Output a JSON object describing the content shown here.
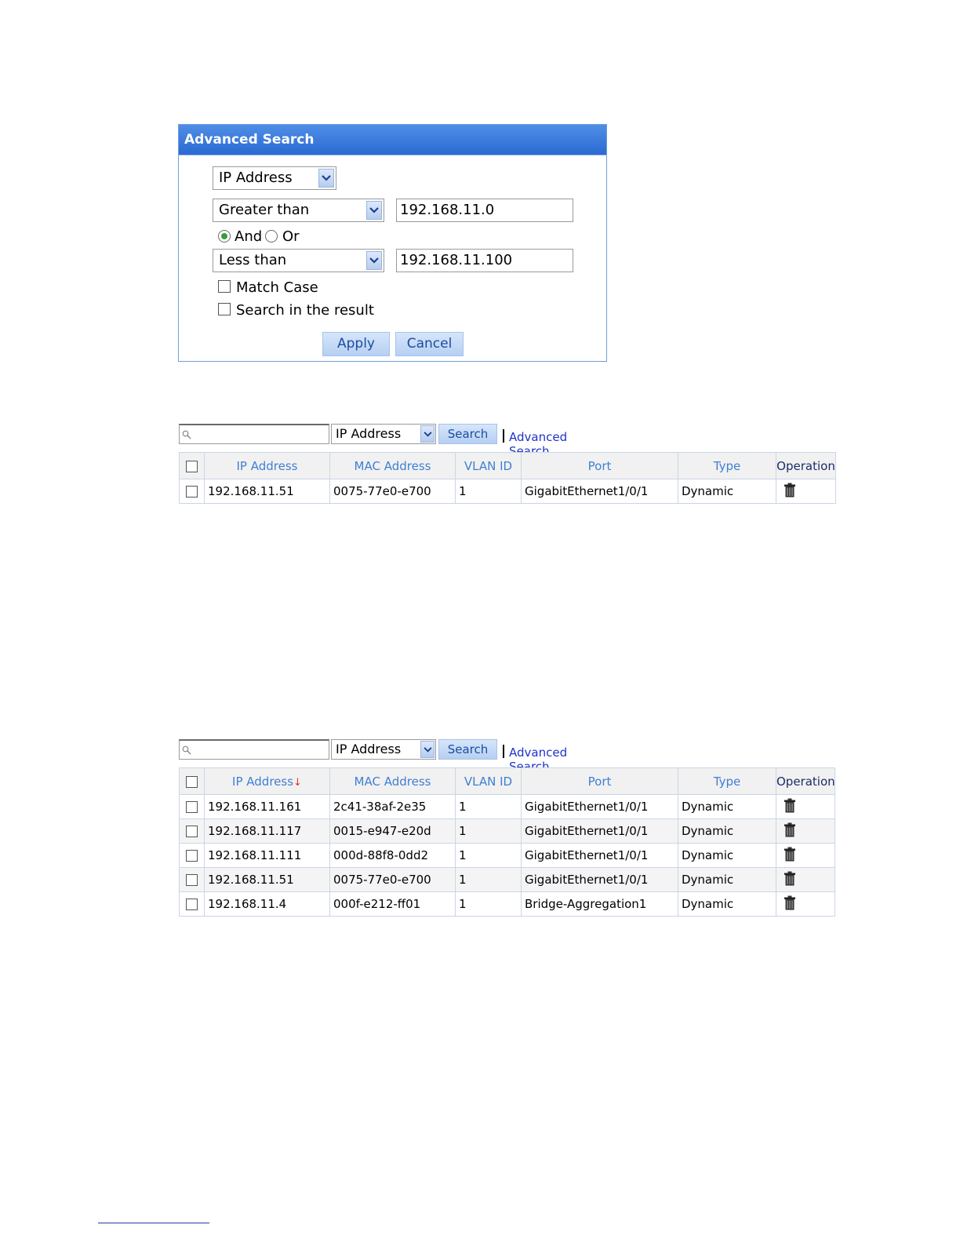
{
  "dialog": {
    "title": "Advanced Search",
    "field_select": "IP Address",
    "condition1": "Greater than",
    "value1": "192.168.11.0",
    "and_label": "And",
    "or_label": "Or",
    "logic_selected": "And",
    "condition2": "Less than",
    "value2": "192.168.11.100",
    "match_case_label": "Match Case",
    "search_result_label": "Search in the result",
    "apply_label": "Apply",
    "cancel_label": "Cancel"
  },
  "search_bar": {
    "field_select": "IP Address",
    "search_label": "Search",
    "advanced_label": "Advanced Search"
  },
  "columns": [
    "IP Address",
    "MAC Address",
    "VLAN ID",
    "Port",
    "Type",
    "Operation"
  ],
  "table1": {
    "rows": [
      {
        "ip": "192.168.11.51",
        "mac": "0075-77e0-e700",
        "vlan": "1",
        "port": "GigabitEthernet1/0/1",
        "type": "Dynamic"
      }
    ]
  },
  "table2": {
    "sort_indicator": "↓",
    "rows": [
      {
        "ip": "192.168.11.161",
        "mac": "2c41-38af-2e35",
        "vlan": "1",
        "port": "GigabitEthernet1/0/1",
        "type": "Dynamic"
      },
      {
        "ip": "192.168.11.117",
        "mac": "0015-e947-e20d",
        "vlan": "1",
        "port": "GigabitEthernet1/0/1",
        "type": "Dynamic"
      },
      {
        "ip": "192.168.11.111",
        "mac": "000d-88f8-0dd2",
        "vlan": "1",
        "port": "GigabitEthernet1/0/1",
        "type": "Dynamic"
      },
      {
        "ip": "192.168.11.51",
        "mac": "0075-77e0-e700",
        "vlan": "1",
        "port": "GigabitEthernet1/0/1",
        "type": "Dynamic"
      },
      {
        "ip": "192.168.11.4",
        "mac": "000f-e212-ff01",
        "vlan": "1",
        "port": "Bridge-Aggregation1",
        "type": "Dynamic"
      }
    ]
  },
  "icons": {
    "dropdown": "chevron-down-icon",
    "search": "magnifier-icon",
    "delete": "trash-icon"
  }
}
